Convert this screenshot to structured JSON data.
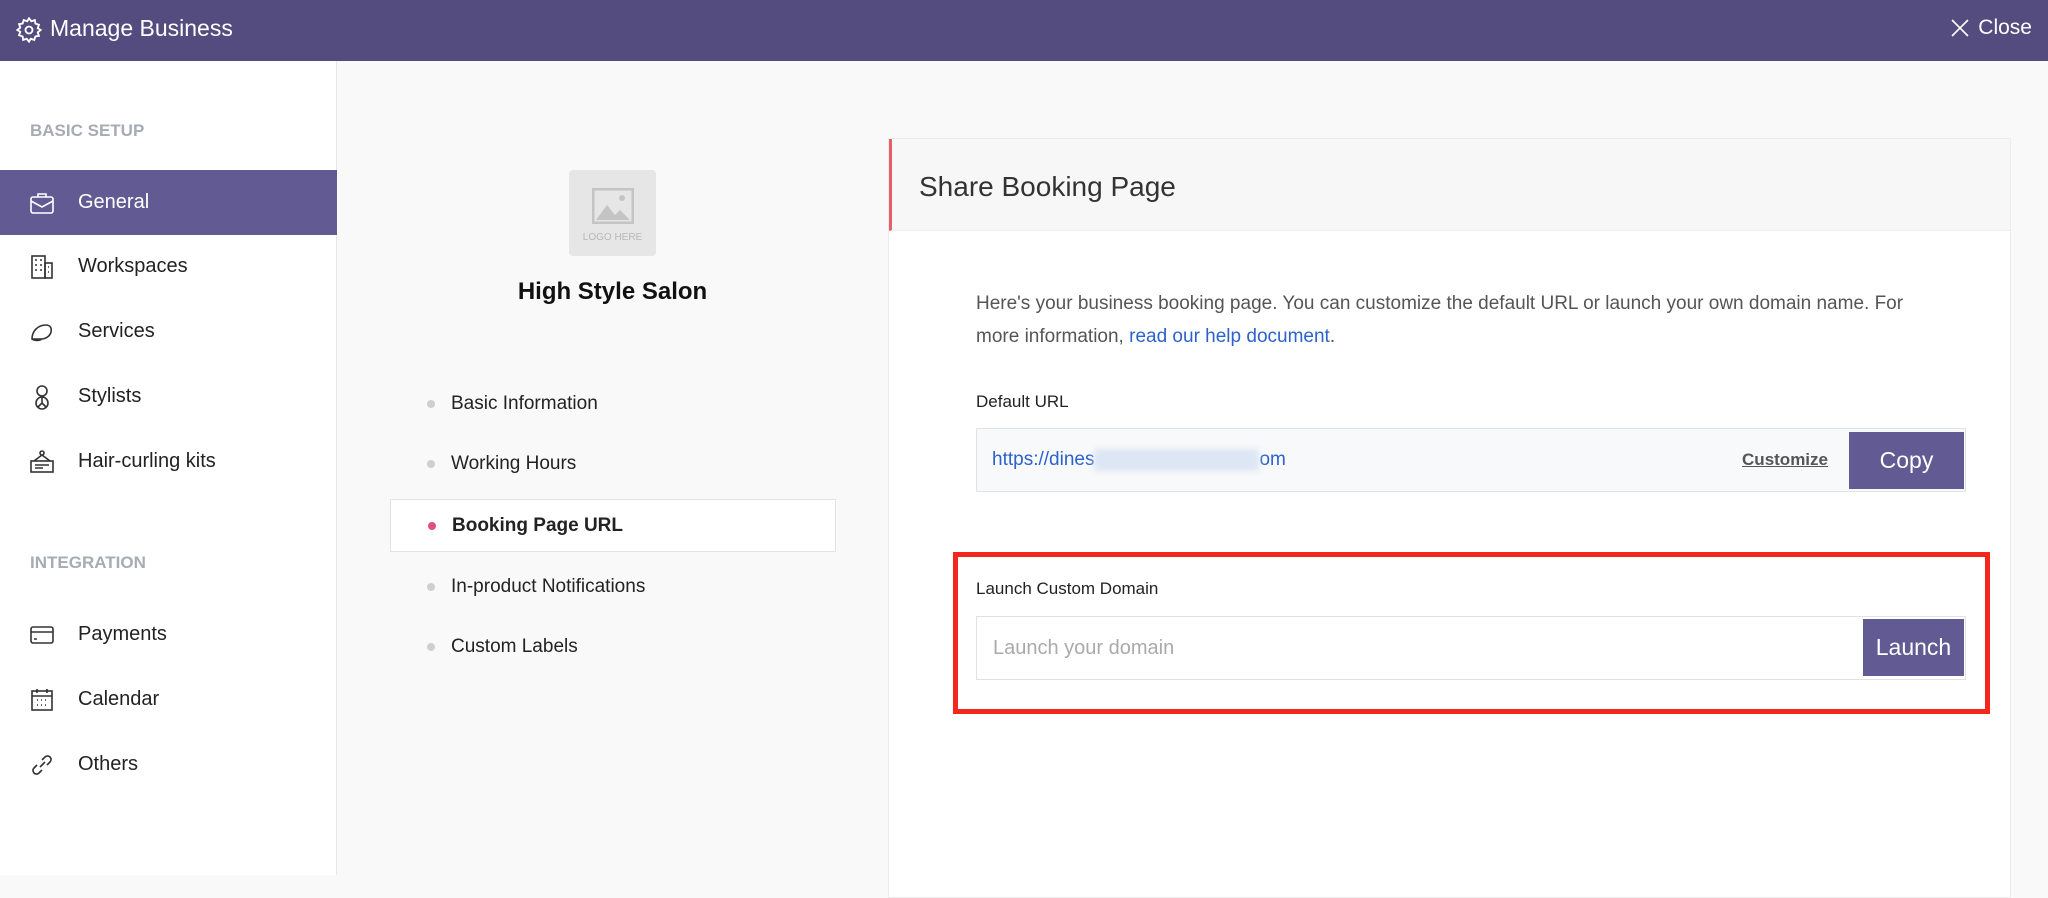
{
  "header": {
    "title": "Manage Business",
    "close_label": "Close",
    "bg": "#544b7e"
  },
  "sidebar": {
    "sections": [
      {
        "label": "BASIC SETUP",
        "items": [
          {
            "label": "General",
            "icon": "briefcase-icon",
            "active": true
          },
          {
            "label": "Workspaces",
            "icon": "building-icon"
          },
          {
            "label": "Services",
            "icon": "cap-icon"
          },
          {
            "label": "Stylists",
            "icon": "person-icon"
          },
          {
            "label": "Hair-curling kits",
            "icon": "signboard-icon"
          }
        ]
      },
      {
        "label": "INTEGRATION",
        "items": [
          {
            "label": "Payments",
            "icon": "credit-card-icon"
          },
          {
            "label": "Calendar",
            "icon": "calendar-icon"
          },
          {
            "label": "Others",
            "icon": "link-icon"
          }
        ]
      }
    ]
  },
  "business": {
    "logo_placeholder": "LOGO HERE",
    "name": "High Style Salon"
  },
  "subnav": [
    "Basic Information",
    "Working Hours",
    "Booking Page URL",
    "In-product Notifications",
    "Custom Labels"
  ],
  "subnav_active": "Booking Page URL",
  "card": {
    "title": "Share Booking Page",
    "description": "Here's your business booking page. You can customize the default URL or launch your own domain name. For more information, ",
    "help_link": "read our help document",
    "help_link_after": ".",
    "default_url_label": "Default URL",
    "url_start": "https://dines",
    "url_end": "om",
    "customize_label": "Customize",
    "copy_label": "Copy",
    "custom_domain_label": "Launch Custom Domain",
    "custom_domain_placeholder": "Launch your domain",
    "launch_label": "Launch"
  },
  "colors": {
    "accent": "#625a92",
    "highlight": "#f2281d",
    "link": "#2c62c9"
  }
}
